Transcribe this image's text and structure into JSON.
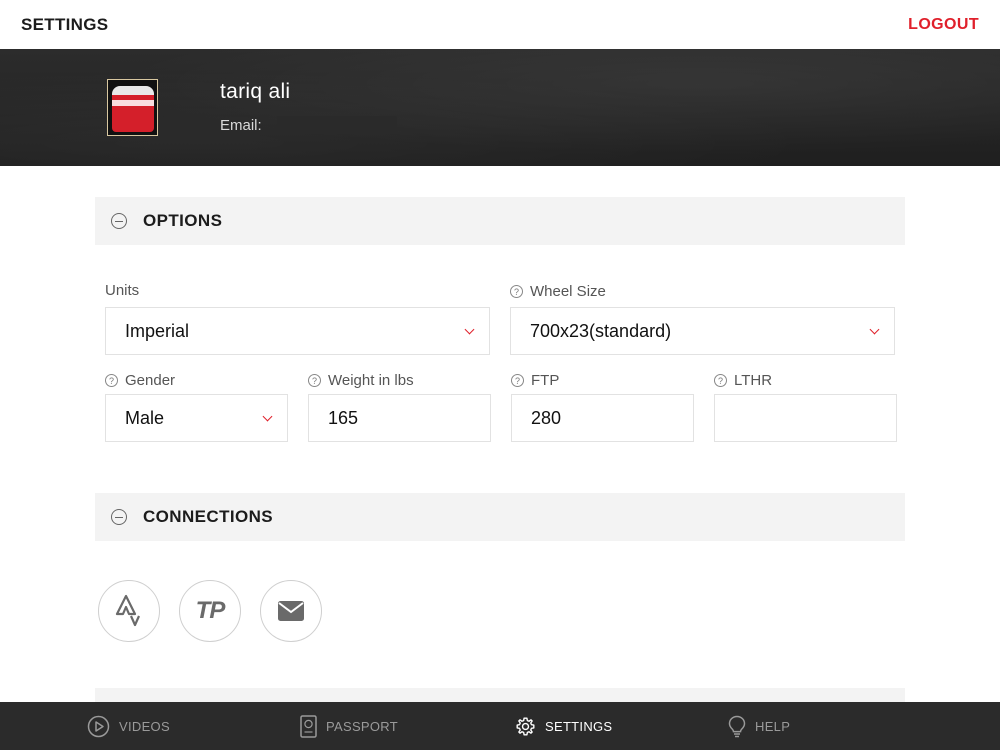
{
  "header": {
    "title": "SETTINGS",
    "logout_label": "LOGOUT"
  },
  "profile": {
    "name": "tariq ali",
    "email_label": "Email:",
    "email_value": ""
  },
  "options": {
    "title": "OPTIONS",
    "units": {
      "label": "Units",
      "value": "Imperial"
    },
    "wheel_size": {
      "label": "Wheel Size",
      "value": "700x23(standard)"
    },
    "gender": {
      "label": "Gender",
      "value": "Male"
    },
    "weight": {
      "label": "Weight in lbs",
      "value": "165"
    },
    "ftp": {
      "label": "FTP",
      "value": "280"
    },
    "lthr": {
      "label": "LTHR",
      "value": ""
    }
  },
  "connections": {
    "title": "CONNECTIONS",
    "items": [
      {
        "icon": "strava-icon"
      },
      {
        "icon": "trainingpeaks-icon",
        "text": "TP"
      },
      {
        "icon": "email-icon"
      }
    ]
  },
  "nav": {
    "items": [
      {
        "label": "VIDEOS",
        "icon": "play-icon",
        "active": false
      },
      {
        "label": "PASSPORT",
        "icon": "passport-icon",
        "active": false
      },
      {
        "label": "SETTINGS",
        "icon": "gear-icon",
        "active": true
      },
      {
        "label": "HELP",
        "icon": "lightbulb-icon",
        "active": false
      }
    ]
  },
  "colors": {
    "accent": "#e0202b",
    "nav_bg": "#2b2b2b",
    "section_bg": "#f3f3f3"
  }
}
